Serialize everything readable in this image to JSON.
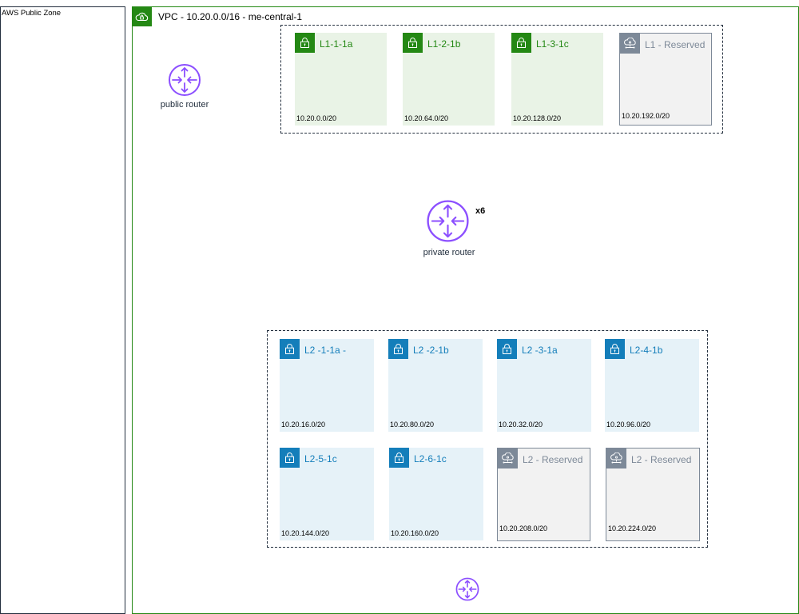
{
  "public_zone": {
    "label": "AWS Public Zone"
  },
  "vpc": {
    "label": "VPC - 10.20.0.0/16 - me-central-1",
    "icon": "cloud-lock-icon",
    "color": "#248814"
  },
  "routers": {
    "public": {
      "label": "public router",
      "icon": "router-icon",
      "color": "#8c4fff"
    },
    "private": {
      "label": "private router",
      "count": "x6",
      "icon": "router-icon",
      "color": "#8c4fff"
    }
  },
  "subnets_l1": [
    {
      "name": "L1-1-1a",
      "cidr": "10.20.0.0/20",
      "kind": "public"
    },
    {
      "name": "L1-2-1b",
      "cidr": "10.20.64.0/20",
      "kind": "public"
    },
    {
      "name": "L1-3-1c",
      "cidr": "10.20.128.0/20",
      "kind": "public"
    },
    {
      "name": "L1 - Reserved",
      "cidr": "10.20.192.0/20",
      "kind": "reserved"
    }
  ],
  "subnets_l2": [
    {
      "name": "L2 -1-1a -",
      "cidr": "10.20.16.0/20",
      "kind": "private"
    },
    {
      "name": "L2 -2-1b",
      "cidr": "10.20.80.0/20",
      "kind": "private"
    },
    {
      "name": "L2 -3-1a",
      "cidr": "10.20.32.0/20",
      "kind": "private"
    },
    {
      "name": "L2-4-1b",
      "cidr": "10.20.96.0/20",
      "kind": "private"
    },
    {
      "name": "L2-5-1c",
      "cidr": "10.20.144.0/20",
      "kind": "private"
    },
    {
      "name": "L2-6-1c",
      "cidr": "10.20.160.0/20",
      "kind": "private"
    },
    {
      "name": "L2  - Reserved",
      "cidr": "10.20.208.0/20",
      "kind": "reserved"
    },
    {
      "name": "L2  - Reserved",
      "cidr": "10.20.224.0/20",
      "kind": "reserved"
    }
  ],
  "colors": {
    "public": "#248814",
    "private": "#147eba",
    "reserved": "#7d8998"
  }
}
